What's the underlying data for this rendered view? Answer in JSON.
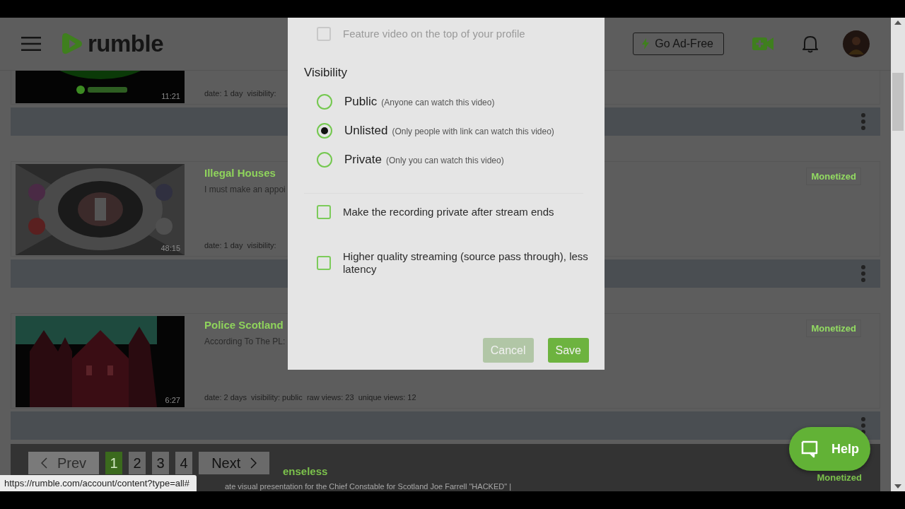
{
  "header": {
    "logo": "rumble",
    "ad_free_button": "Go Ad-Free"
  },
  "videos": [
    {
      "duration": "11:21",
      "meta": "date: 1 day  visibility:"
    },
    {
      "title": "Illegal Houses",
      "description": "I must make an appoi",
      "duration": "48:15",
      "meta": "date: 1 day  visibility:",
      "badge": "Monetized"
    },
    {
      "title": "Police Scotland",
      "description": "According To The PL:",
      "duration": "6:27",
      "meta": "date: 2 days  visibility: public  raw views: 23  unique views: 12",
      "badge": "Monetized"
    }
  ],
  "partial_video": {
    "title": "enseless",
    "description": "ate visual presentation for the Chief Constable for Scotland Joe Farrell \"HACKED\" |",
    "badge": "Monetized"
  },
  "pagination": {
    "prev": "Prev",
    "pages": [
      {
        "label": "1",
        "selected": true
      },
      {
        "label": "2",
        "selected": false
      },
      {
        "label": "3",
        "selected": false
      },
      {
        "label": "4",
        "selected": false
      }
    ],
    "next": "Next"
  },
  "modal": {
    "feature_option": {
      "label": "Feature video on the top of your profile",
      "checked": false,
      "disabled": true
    },
    "section_title": "Visibility",
    "visibility_options": [
      {
        "label": "Public",
        "hint": "(Anyone can watch this video)",
        "selected": false
      },
      {
        "label": "Unlisted",
        "hint": "(Only people with link can watch this video)",
        "selected": true
      },
      {
        "label": "Private",
        "hint": "(Only you can watch this video)",
        "selected": false
      }
    ],
    "options": [
      {
        "label": "Make the recording private after stream ends",
        "checked": false
      },
      {
        "label": "Higher quality streaming (source pass through), less latency",
        "checked": false
      }
    ],
    "cancel_button": {
      "label": "Cancel",
      "disabled": true
    },
    "save_button": "Save"
  },
  "help_button": "Help",
  "status_url": "https://rumble.com/account/content?type=all#"
}
